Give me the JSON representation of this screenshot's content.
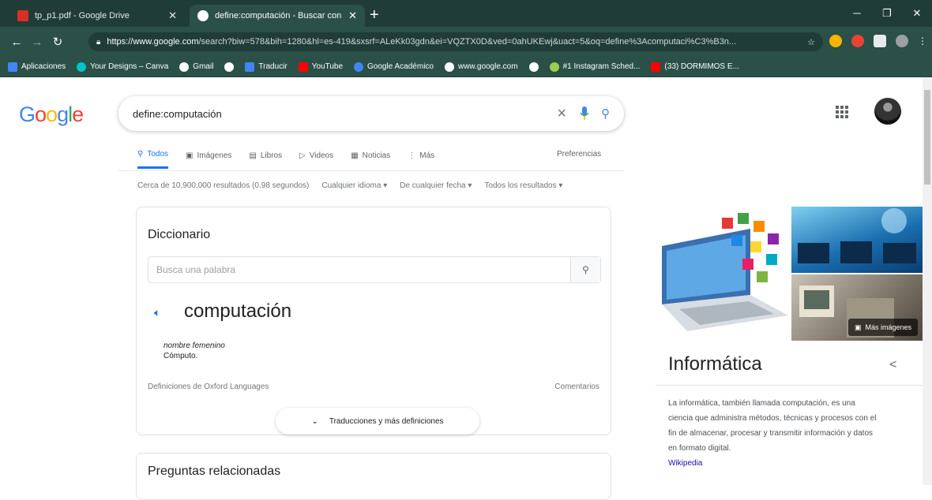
{
  "browser": {
    "tabs": [
      {
        "title": "tp_p1.pdf - Google Drive",
        "active": false
      },
      {
        "title": "define:computación - Buscar con G",
        "active": true
      }
    ],
    "url_host": "https://www.google.com",
    "url_rest": "/search?biw=578&bih=1280&hl=es-419&sxsrf=ALeKk03gdn&ei=VQZTX0D&ved=0ahUKEwj&uact=5&oq=define%3Acomputaci%C3%B3n...",
    "bookmarks": [
      "Aplicaciones",
      "Your Designs – Canva",
      "Gmail",
      "",
      "Traducir",
      "YouTube",
      "Google Académico",
      "www.google.com",
      "",
      "#1 Instagram Sched...",
      "(33) DORMIMOS E..."
    ]
  },
  "search": {
    "logo": "Google",
    "query": "define:computación",
    "tabs": [
      "Todos",
      "Imágenes",
      "Libros",
      "Videos",
      "Noticias",
      "Más"
    ],
    "preferences": "Preferencias",
    "result_count": "Cerca de 10,900,000 resultados (0.98 segundos)",
    "language_filter": "Cualquier idioma ▾",
    "date_filter": "De cualquier fecha ▾",
    "results_filter": "Todos los resultados ▾"
  },
  "dictionary": {
    "heading": "Diccionario",
    "placeholder": "Busca una palabra",
    "word": "computación",
    "part_of_speech": "nombre femenino",
    "definition": "Cómputo.",
    "source": "Definiciones de Oxford Languages",
    "feedback": "Comentarios",
    "more_button": "Traducciones y más definiciones"
  },
  "related": {
    "heading": "Preguntas relacionadas"
  },
  "knowledge_panel": {
    "title": "Informática",
    "more_images": "Más imágenes",
    "description": "La informática, también llamada computación, es una ciencia que administra métodos, técnicas y procesos con el fin de almacenar, procesar y transmitir información y datos en formato digital.",
    "source_link": "Wikipedia"
  },
  "colors": {
    "chrome_dark": "#1f3d36",
    "chrome_toolbar": "#2b5048",
    "google_blue": "#4285f4",
    "link_blue": "#1a0dab"
  }
}
